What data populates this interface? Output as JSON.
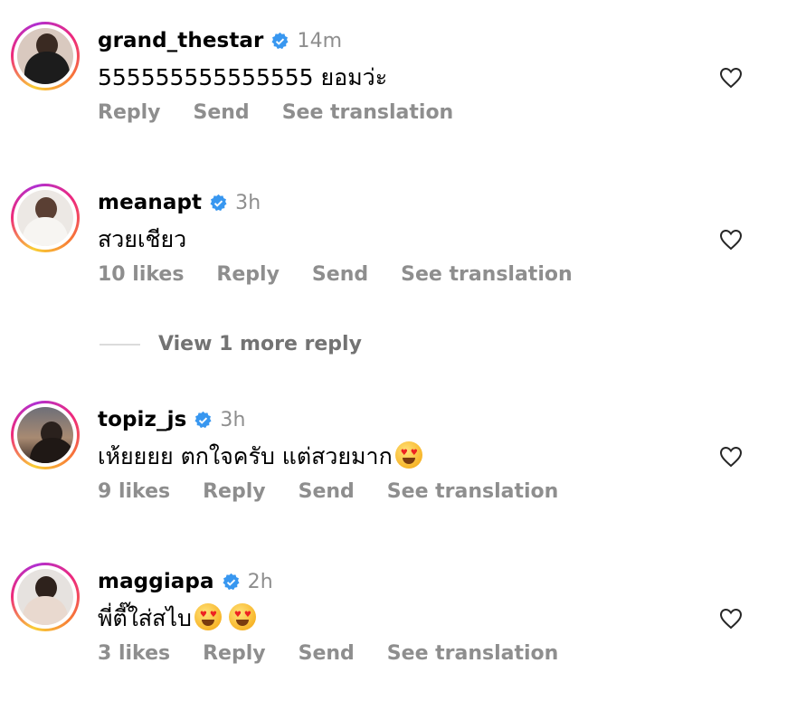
{
  "comments": [
    {
      "username": "grand_thestar",
      "time": "14m",
      "text": "555555555555555 ยอมว่ะ",
      "likes": "",
      "actions": [
        "Reply",
        "Send",
        "See translation"
      ],
      "avatar_icon": "avatar-photo"
    },
    {
      "username": "meanapt",
      "time": "3h",
      "text": "สวยเชียว",
      "likes": "10 likes",
      "actions": [
        "Reply",
        "Send",
        "See translation"
      ],
      "avatar_icon": "avatar-photo"
    },
    {
      "username": "topiz_js",
      "time": "3h",
      "text": "เห้ยยยย ตกใจครับ แต่สวยมาก",
      "likes": "9 likes",
      "actions": [
        "Reply",
        "Send",
        "See translation"
      ],
      "avatar_icon": "avatar-photo"
    },
    {
      "username": "maggiapa",
      "time": "2h",
      "text": "พี่ตี๊ใส่สไบ",
      "likes": "3 likes",
      "actions": [
        "Reply",
        "Send",
        "See translation"
      ],
      "avatar_icon": "avatar-photo"
    }
  ],
  "view_more_replies": "View 1 more reply",
  "colors": {
    "verified": "#3897f0",
    "secondary_text": "#8e8e8e",
    "story_ring": [
      "#f9ce34",
      "#ee2a7b",
      "#b02fd1"
    ]
  }
}
